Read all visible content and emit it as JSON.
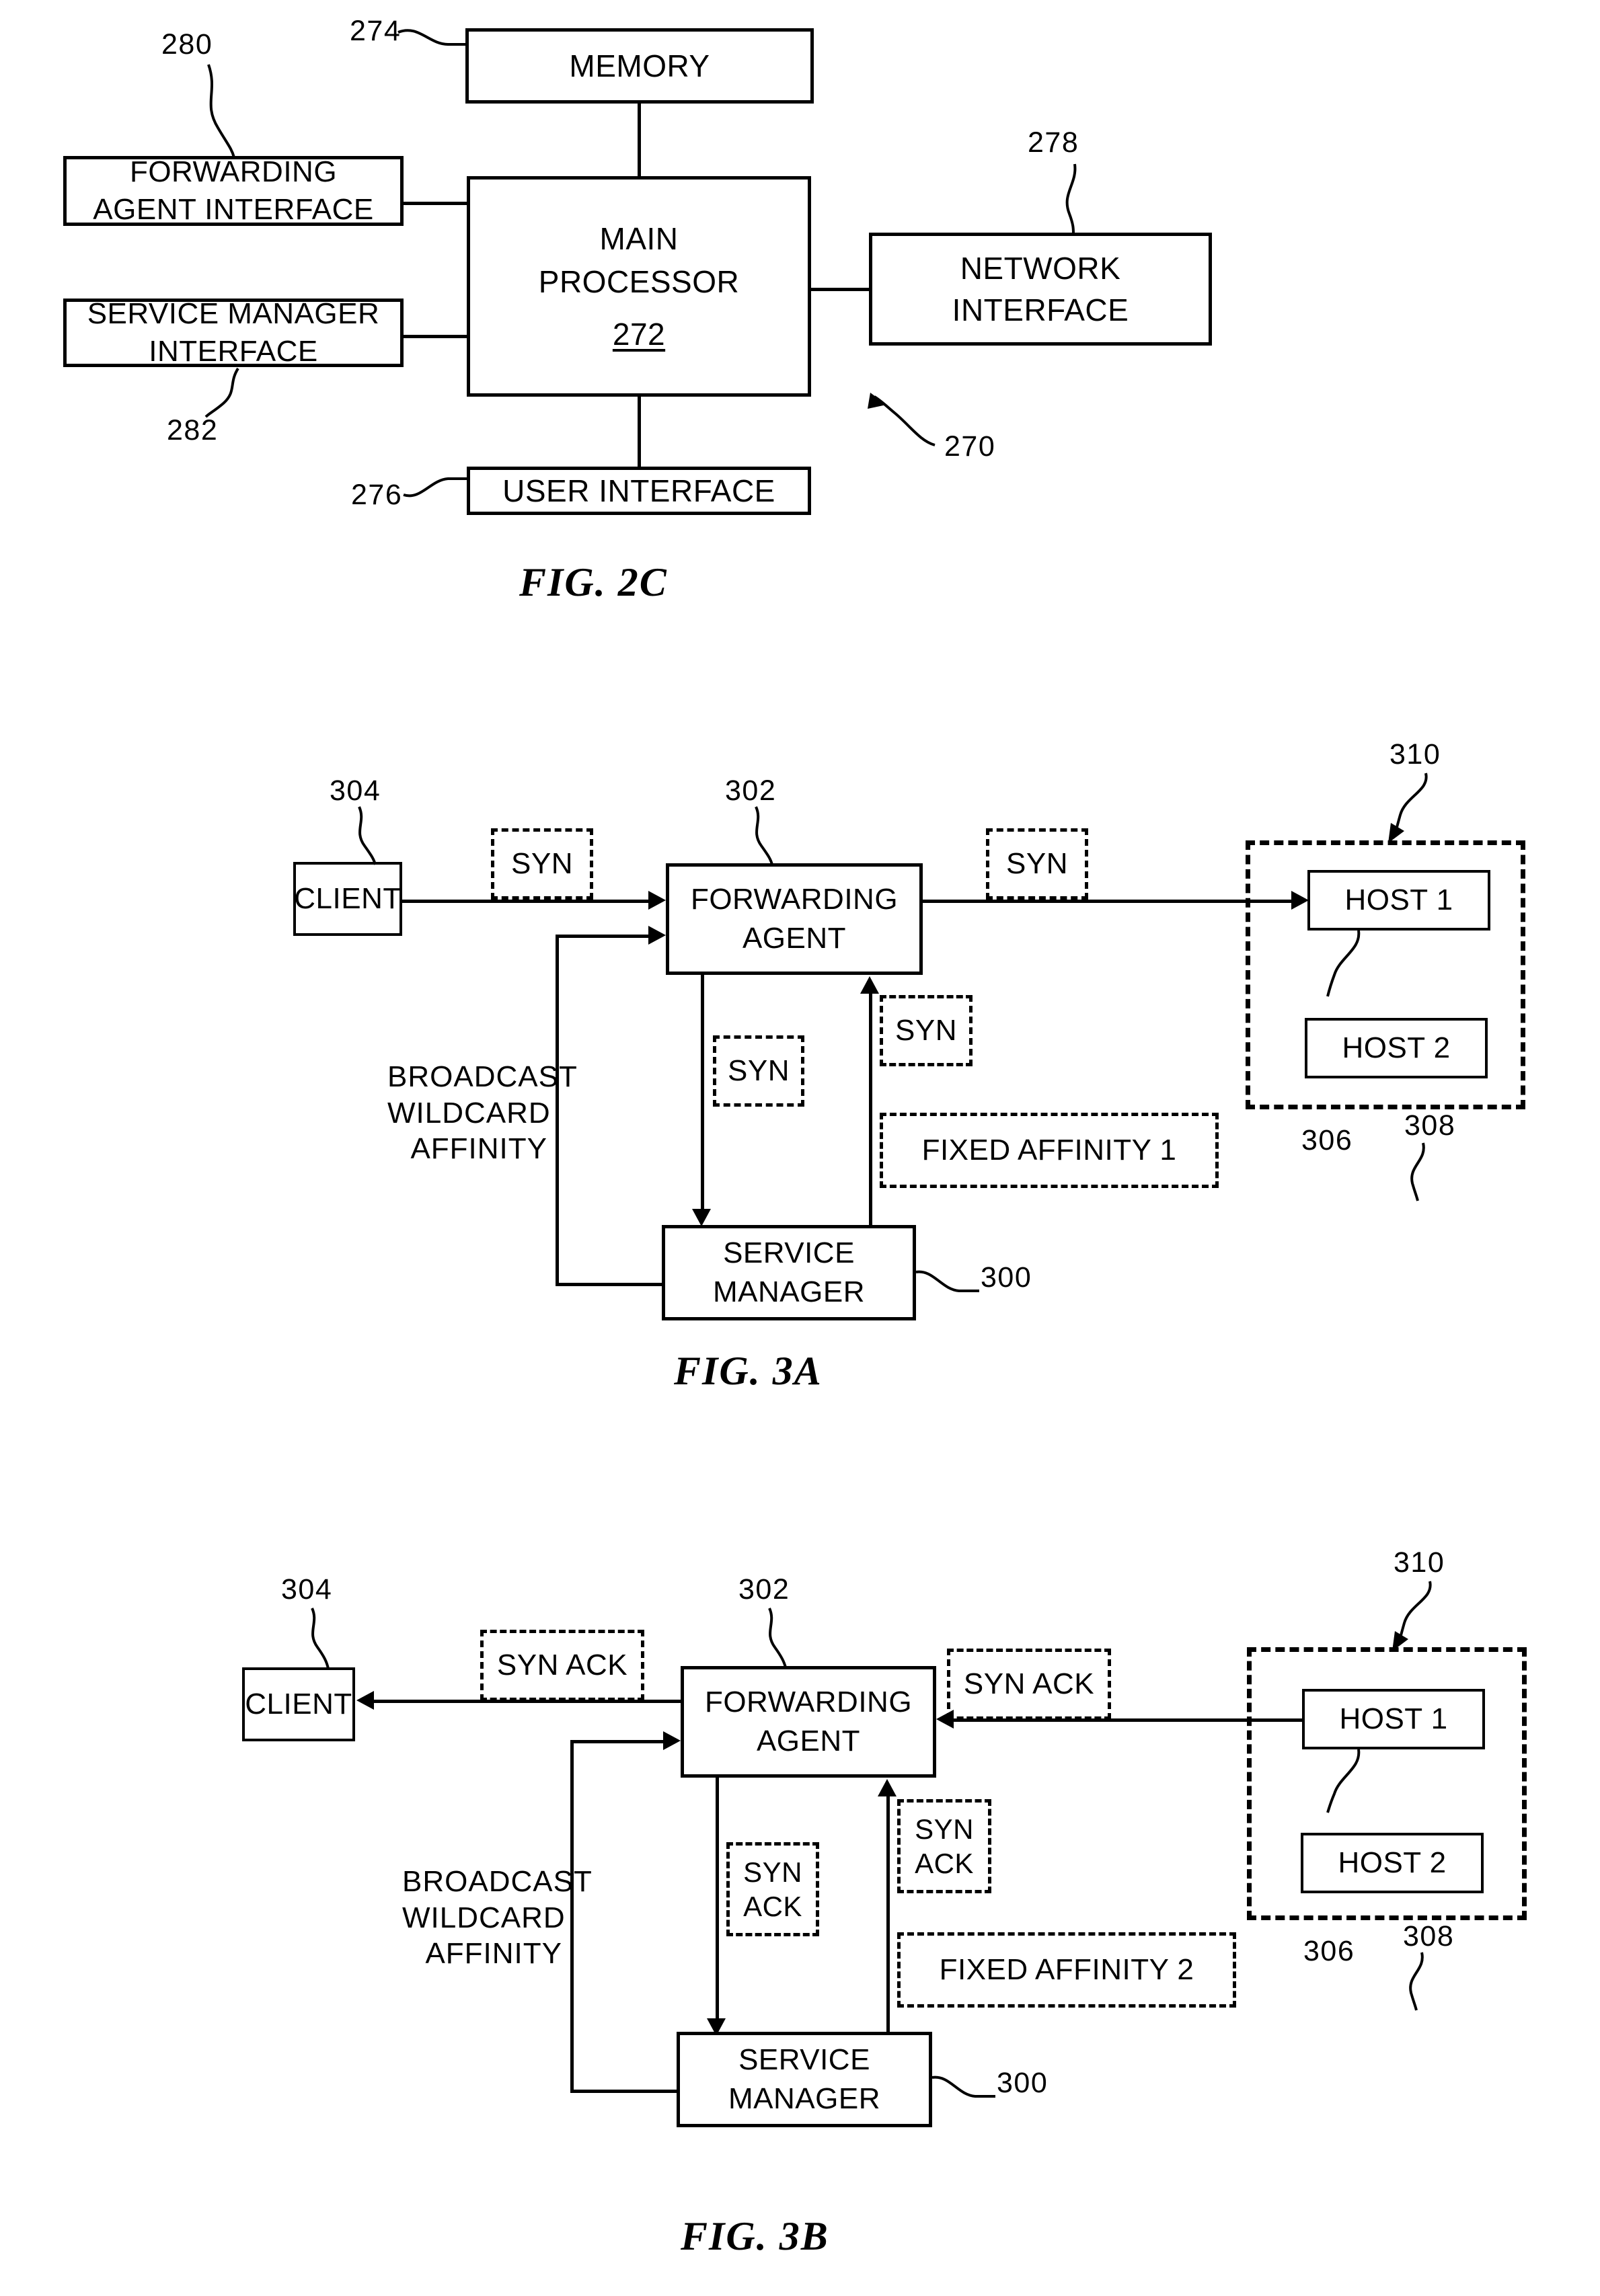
{
  "page": {
    "background": "#ffffff",
    "ink": "#000000"
  },
  "figures": [
    {
      "id": "fig2c",
      "caption": "FIG. 2C",
      "system_ref": "270",
      "boxes": [
        {
          "key": "memory",
          "label": "MEMORY",
          "ref": "274"
        },
        {
          "key": "main_processor",
          "label": "MAIN\nPROCESSOR",
          "ref": "272",
          "ref_inside": true
        },
        {
          "key": "forwarding_agent_interface",
          "label": "FORWARDING\nAGENT INTERFACE",
          "ref": "280"
        },
        {
          "key": "service_manager_interface",
          "label": "SERVICE MANAGER\nINTERFACE",
          "ref": "282"
        },
        {
          "key": "network_interface",
          "label": "NETWORK\nINTERFACE",
          "ref": "278"
        },
        {
          "key": "user_interface",
          "label": "USER INTERFACE",
          "ref": "276"
        }
      ]
    },
    {
      "id": "fig3a",
      "caption": "FIG. 3A",
      "boxes": [
        {
          "key": "client",
          "label": "CLIENT",
          "ref": "304"
        },
        {
          "key": "forwarding_agent",
          "label": "FORWARDING\nAGENT",
          "ref": "302"
        },
        {
          "key": "service_manager",
          "label": "SERVICE\nMANAGER",
          "ref": "300"
        },
        {
          "key": "host1",
          "label": "HOST 1",
          "ref": "306"
        },
        {
          "key": "host2",
          "label": "HOST 2",
          "ref": "308"
        },
        {
          "key": "host_group",
          "label": "",
          "ref": "310"
        }
      ],
      "packets": [
        {
          "key": "syn_client_fa",
          "label": "SYN"
        },
        {
          "key": "syn_fa_host",
          "label": "SYN"
        },
        {
          "key": "syn_fa_sm",
          "label": "SYN"
        },
        {
          "key": "syn_sm_fa",
          "label": "SYN"
        },
        {
          "key": "fixed_affinity",
          "label": "FIXED AFFINITY 1"
        }
      ],
      "annotations": [
        {
          "key": "broadcast_wildcard_affinity",
          "lines": [
            "BROADCAST",
            "WILDCARD",
            "AFFINITY"
          ]
        }
      ]
    },
    {
      "id": "fig3b",
      "caption": "FIG. 3B",
      "boxes": [
        {
          "key": "client",
          "label": "CLIENT",
          "ref": "304"
        },
        {
          "key": "forwarding_agent",
          "label": "FORWARDING\nAGENT",
          "ref": "302"
        },
        {
          "key": "service_manager",
          "label": "SERVICE\nMANAGER",
          "ref": "300"
        },
        {
          "key": "host1",
          "label": "HOST 1",
          "ref": "306"
        },
        {
          "key": "host2",
          "label": "HOST 2",
          "ref": "308"
        },
        {
          "key": "host_group",
          "label": "",
          "ref": "310"
        }
      ],
      "packets": [
        {
          "key": "synack_fa_client",
          "label": "SYN ACK"
        },
        {
          "key": "synack_host_fa",
          "label": "SYN ACK"
        },
        {
          "key": "synack_fa_sm",
          "label": "SYN\nACK"
        },
        {
          "key": "synack_sm_fa",
          "label": "SYN\nACK"
        },
        {
          "key": "fixed_affinity",
          "label": "FIXED AFFINITY 2"
        }
      ],
      "annotations": [
        {
          "key": "broadcast_wildcard_affinity",
          "lines": [
            "BROADCAST",
            "WILDCARD",
            "AFFINITY"
          ]
        }
      ]
    }
  ],
  "fig2c": {
    "caption": "FIG. 2C",
    "memory": "MEMORY",
    "memory_ref": "274",
    "main_processor_l1": "MAIN",
    "main_processor_l2": "PROCESSOR",
    "main_processor_ref": "272",
    "fwd_agent_if_l1": "FORWARDING",
    "fwd_agent_if_l2": "AGENT INTERFACE",
    "fwd_agent_if_ref": "280",
    "svc_mgr_if_l1": "SERVICE MANAGER",
    "svc_mgr_if_l2": "INTERFACE",
    "svc_mgr_if_ref": "282",
    "network_if_l1": "NETWORK",
    "network_if_l2": "INTERFACE",
    "network_if_ref": "278",
    "user_if": "USER INTERFACE",
    "user_if_ref": "276",
    "system_ref": "270"
  },
  "fig3a": {
    "caption": "FIG. 3A",
    "client": "CLIENT",
    "client_ref": "304",
    "fwd_agent_l1": "FORWARDING",
    "fwd_agent_l2": "AGENT",
    "fwd_agent_ref": "302",
    "svc_mgr_l1": "SERVICE",
    "svc_mgr_l2": "MANAGER",
    "svc_mgr_ref": "300",
    "host1": "HOST 1",
    "host1_ref": "306",
    "host2": "HOST 2",
    "host2_ref": "308",
    "host_group_ref": "310",
    "syn_a": "SYN",
    "syn_b": "SYN",
    "syn_c": "SYN",
    "syn_d": "SYN",
    "fixed_affinity": "FIXED AFFINITY 1",
    "bwa_l1": "BROADCAST",
    "bwa_l2": "WILDCARD",
    "bwa_l3": "AFFINITY"
  },
  "fig3b": {
    "caption": "FIG. 3B",
    "client": "CLIENT",
    "client_ref": "304",
    "fwd_agent_l1": "FORWARDING",
    "fwd_agent_l2": "AGENT",
    "fwd_agent_ref": "302",
    "svc_mgr_l1": "SERVICE",
    "svc_mgr_l2": "MANAGER",
    "svc_mgr_ref": "300",
    "host1": "HOST 1",
    "host1_ref": "306",
    "host2": "HOST 2",
    "host2_ref": "308",
    "host_group_ref": "310",
    "synack_a": "SYN ACK",
    "synack_b": "SYN ACK",
    "synack_c_l1": "SYN",
    "synack_c_l2": "ACK",
    "synack_d_l1": "SYN",
    "synack_d_l2": "ACK",
    "fixed_affinity": "FIXED AFFINITY 2",
    "bwa_l1": "BROADCAST",
    "bwa_l2": "WILDCARD",
    "bwa_l3": "AFFINITY"
  }
}
